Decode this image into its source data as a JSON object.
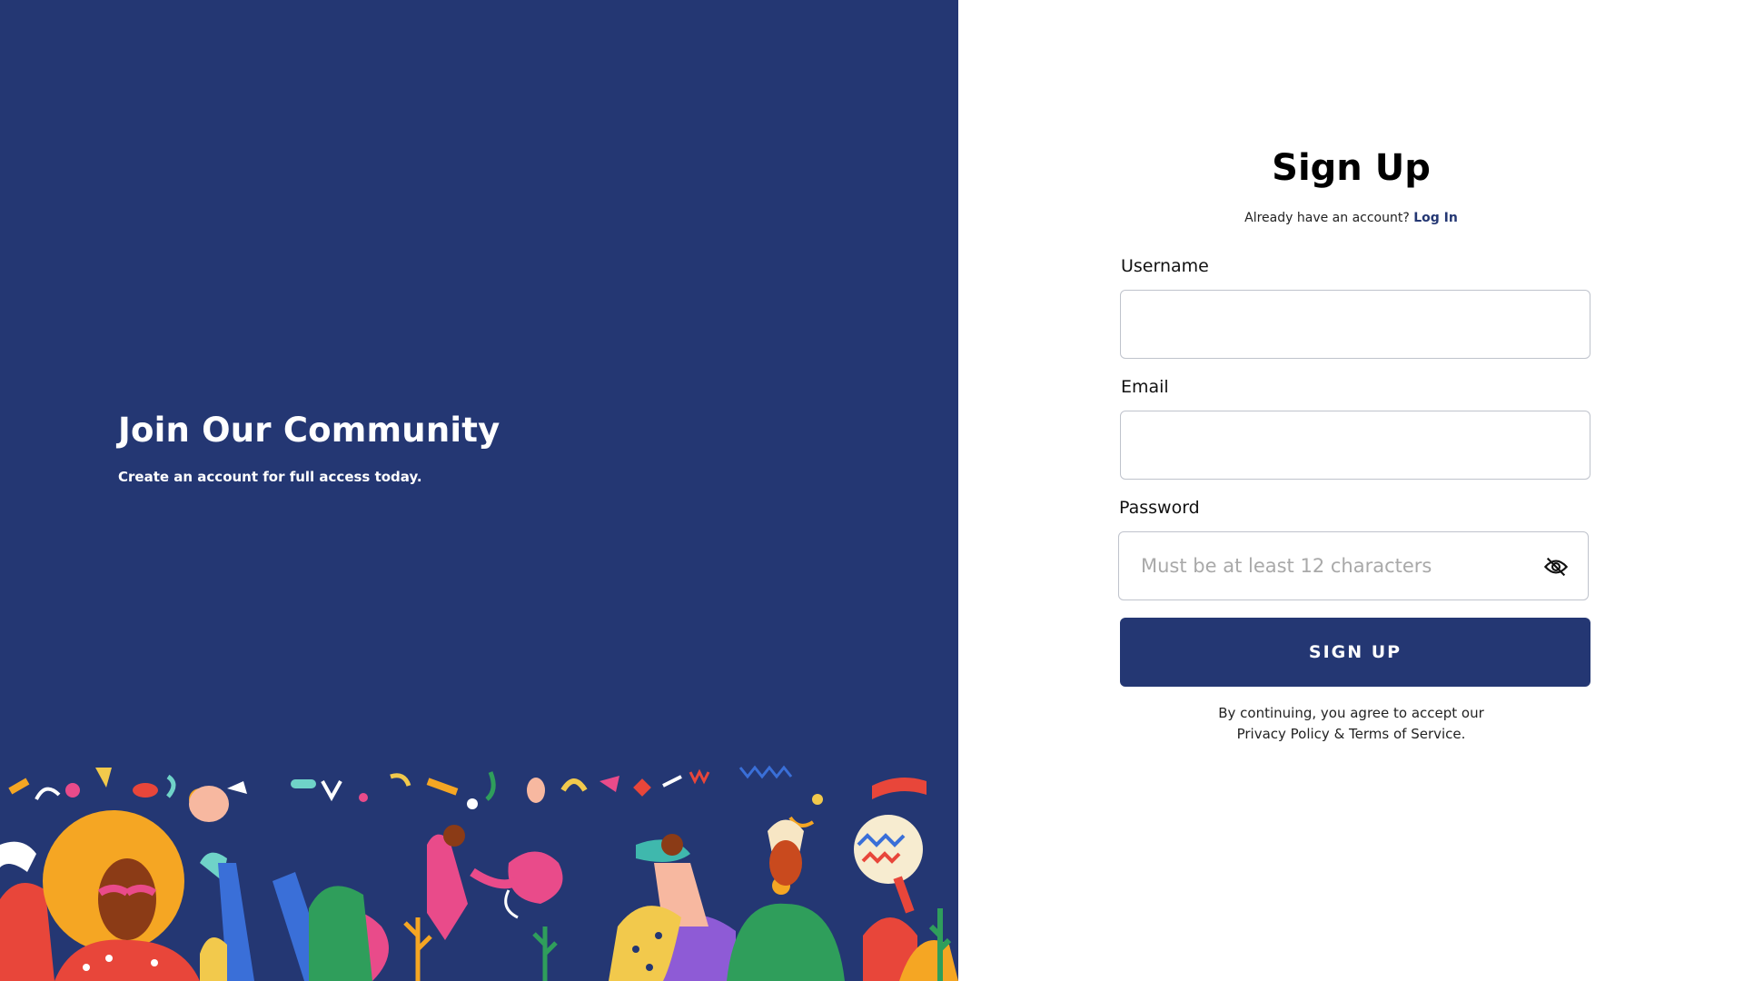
{
  "hero": {
    "title": "Join Our Community",
    "subtitle": "Create an account for full access today."
  },
  "form": {
    "title": "Sign Up",
    "login_prompt": "Already have an account?",
    "login_link": "Log In",
    "username_label": "Username",
    "username_value": "",
    "email_label": "Email",
    "email_value": "",
    "password_label": "Password",
    "password_placeholder": "Must be at least 12 characters",
    "password_toggle_icon": "eye-off-icon",
    "submit_label": "SIGN UP",
    "terms_line1": "By continuing, you agree to accept our",
    "terms_line2": "Privacy Policy & Terms of Service."
  },
  "colors": {
    "brand_navy": "#243773",
    "illustration_palette": [
      "#f5a623",
      "#e94b8a",
      "#2f9e5b",
      "#f2c94c",
      "#e8463a",
      "#6fd3c8",
      "#f7b8a0",
      "#8e5bd6"
    ]
  }
}
